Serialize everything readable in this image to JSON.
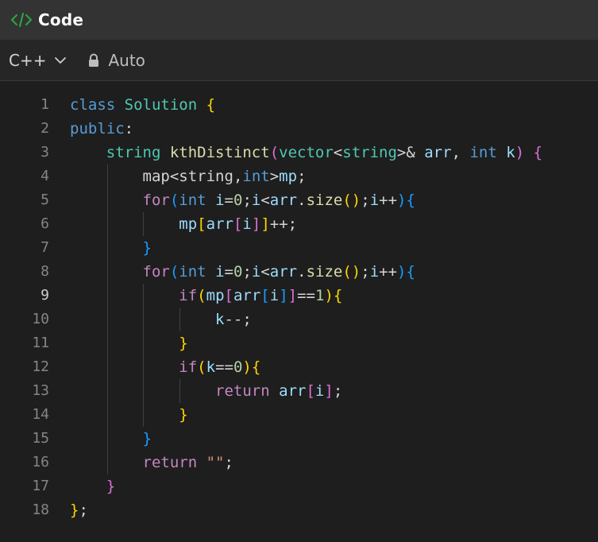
{
  "header": {
    "title": "Code",
    "icon": "code-icon",
    "icon_color": "#2ea043"
  },
  "toolbar": {
    "language": "C++",
    "mode": "Auto"
  },
  "editor": {
    "active_line": 9,
    "line_numbers": [
      "1",
      "2",
      "3",
      "4",
      "5",
      "6",
      "7",
      "8",
      "9",
      "10",
      "11",
      "12",
      "13",
      "14",
      "15",
      "16",
      "17",
      "18"
    ],
    "lines": [
      "class Solution {",
      "public:",
      "    string kthDistinct(vector<string>& arr, int k) {",
      "        map<string,int>mp;",
      "        for(int i=0;i<arr.size();i++){",
      "            mp[arr[i]]++;",
      "        }",
      "        for(int i=0;i<arr.size();i++){",
      "            if(mp[arr[i]]==1){",
      "                k--;",
      "            }",
      "            if(k==0){",
      "                return arr[i];",
      "            }",
      "        }",
      "        return \"\";",
      "    }",
      "};"
    ]
  }
}
